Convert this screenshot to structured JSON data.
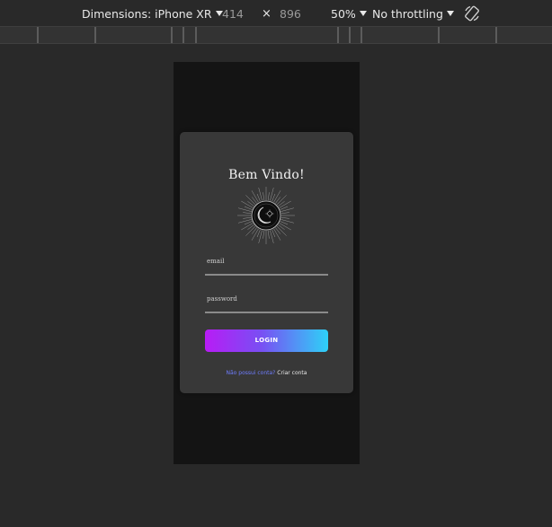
{
  "devtools": {
    "device_label": "Dimensions: iPhone XR",
    "width_value": "414",
    "times_sign": "×",
    "height_value": "896",
    "zoom_label": "50%",
    "throttling_label": "No throttling",
    "rotate_icon": "rotate-icon"
  },
  "app": {
    "title": "Bem Vindo!",
    "logo_icon": "moon-sun-emblem-icon",
    "email_placeholder": "email",
    "password_placeholder": "password",
    "login_label": "LOGIN",
    "signup_prompt": "Não possui conta?",
    "signup_link": "Criar conta",
    "accent_gradient": [
      "#b81cf5",
      "#2ed1f7"
    ],
    "link_color": "#6f7dff"
  }
}
